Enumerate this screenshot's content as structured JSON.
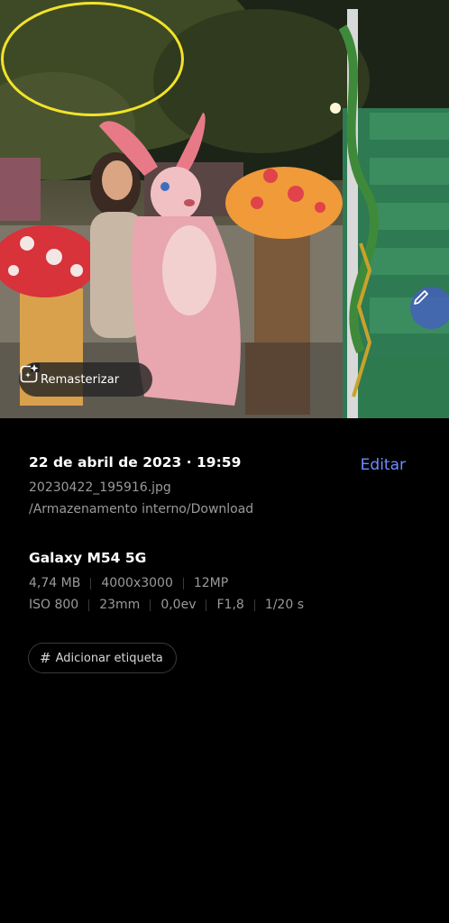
{
  "photo": {
    "remaster_label": "Remasterizar",
    "remaster_icon": "magic-sparkle-image-icon",
    "floating_edit_icon": "pencil-icon",
    "highlight_color": "#f2e32a"
  },
  "details": {
    "date_time": "22 de abril de 2023 · 19:59",
    "edit_label": "Editar",
    "filename": "20230422_195916.jpg",
    "path": "/Armazenamento interno/Download",
    "device": "Galaxy M54 5G",
    "specs_row1": [
      "4,74 MB",
      "4000x3000",
      "12MP"
    ],
    "specs_row2": [
      "ISO 800",
      "23mm",
      "0,0ev",
      "F1,8",
      "1/20 s"
    ],
    "tag_label": "Adicionar etiqueta",
    "tag_icon": "hash-icon"
  },
  "colors": {
    "accent": "#6e8cff",
    "background": "#000000",
    "secondary_text": "#9a9a9a"
  }
}
